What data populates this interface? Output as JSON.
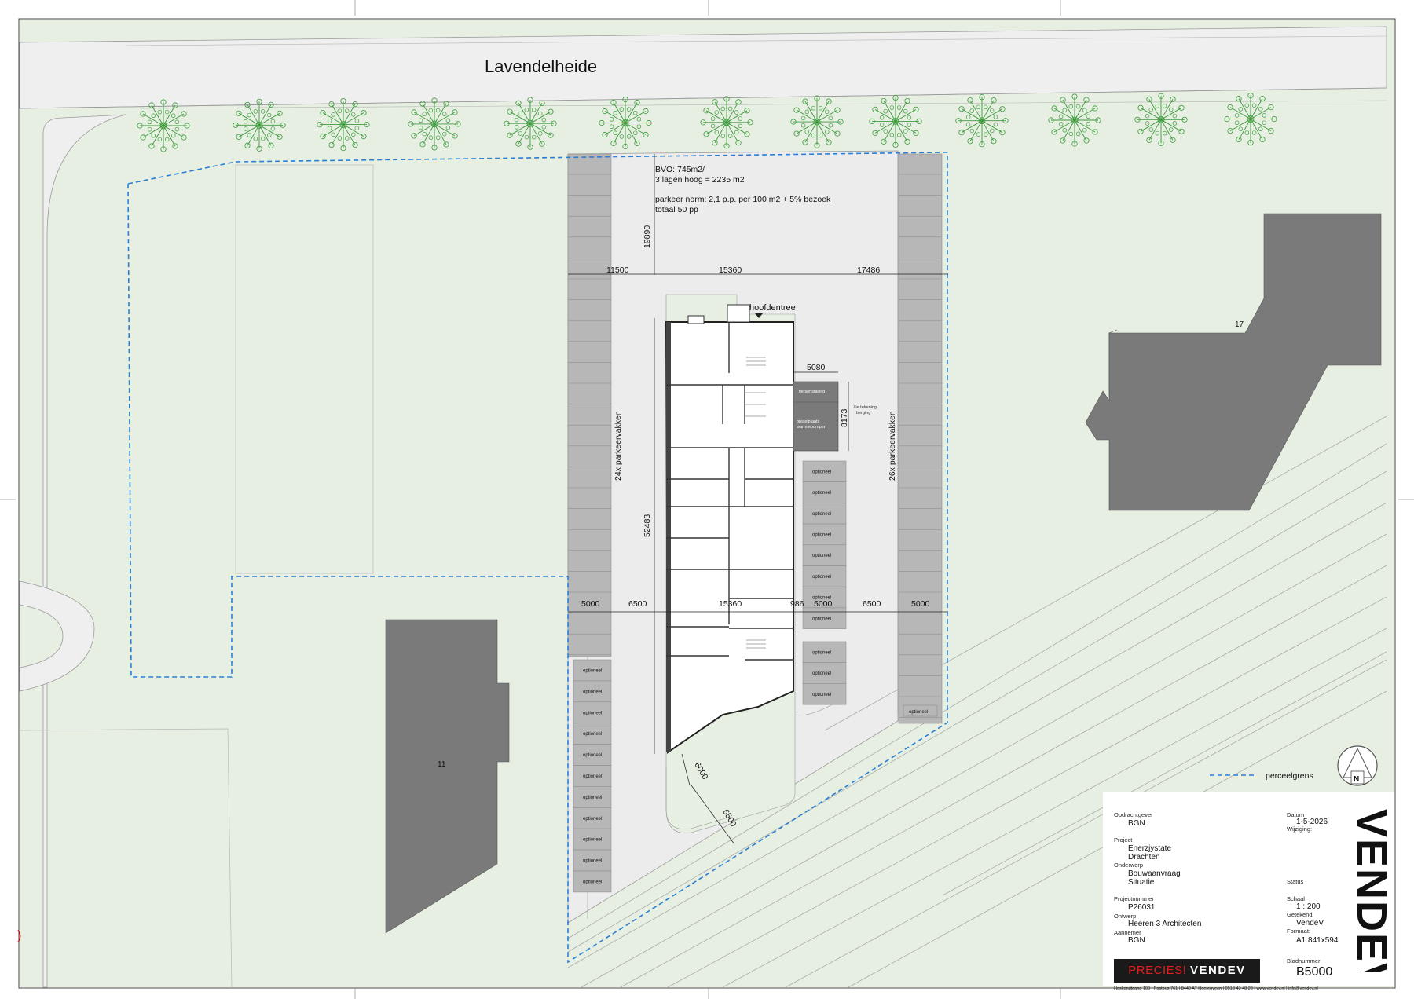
{
  "drawing": {
    "street_name": "Lavendelheide",
    "program_notes": [
      "BVO: 745m2/",
      "3 lagen hoog  = 2235 m2",
      "parkeer norm: 2,1 p.p. per 100 m2 + 5% bezoek",
      "totaal 50 pp"
    ],
    "dimensions_top": [
      "11500",
      "15360",
      "17486"
    ],
    "dimension_vertical_top": "19890",
    "dimension_vertical_main": "52483",
    "dimensions_bottom": [
      "5000",
      "6500",
      "15360",
      "986",
      "5000",
      "6500",
      "5000"
    ],
    "dimension_shed_width": "5080",
    "dimension_shed_height": "8173",
    "dimension_diag_1": "6000",
    "dimension_diag_2": "6500",
    "entrance_label": "hoofdentree",
    "parking_left_label": "24x parkeervakken",
    "parking_right_label": "26x parkeervakken",
    "optional_label": "optioneel",
    "storage_label": "fietsenstalling",
    "heatpump_label": "opstelplaats warmtepompen",
    "see_drawing_note": "Zie tekening berging",
    "building_17": "17",
    "building_11": "11",
    "legend_label": "perceelgrens",
    "north_label": "N",
    "edge_mark": ")"
  },
  "title_block": {
    "client_label": "Opdrachtgever",
    "client": "BGN",
    "project_label": "Project",
    "project_line1": "Enerzjystate",
    "project_line2": "Drachten",
    "subject_label": "Onderwerp",
    "subject_line1": "Bouwaanvraag",
    "subject_line2": "Situatie",
    "project_number_label": "Projectnummer",
    "project_number": "P26031",
    "design_label": "Ontwerp",
    "design": "Heeren 3 Architecten",
    "contractor_label": "Aannemer",
    "contractor": "BGN",
    "date_label": "Datum",
    "date": "1-5-2026",
    "revision_label": "Wijziging:",
    "status_label": "Status",
    "scale_label": "Schaal",
    "scale": "1 : 200",
    "drawn_label": "Getekend",
    "drawn": "VendeV",
    "format_label": "Formaat:",
    "format": "A1 841x594",
    "sheet_label": "Bladnummer",
    "sheet": "B5000",
    "brand_prefix": "PRECIES!",
    "brand_name": "VENDEV",
    "vertical_logo": "VENDEV",
    "footer_address": "Haskeruitgang 109 | Postbus 761 | 8440 AT Heerenveen | 0513 43 48 23 | www.vendev.nl | info@vendev.nl"
  },
  "colors": {
    "grass": "#e6efe1",
    "road": "#efefef",
    "parking": "#b7b7b7",
    "building_dark": "#7a7a7a",
    "tree": "#3c9a3c",
    "boundary": "#2a7fd4"
  }
}
